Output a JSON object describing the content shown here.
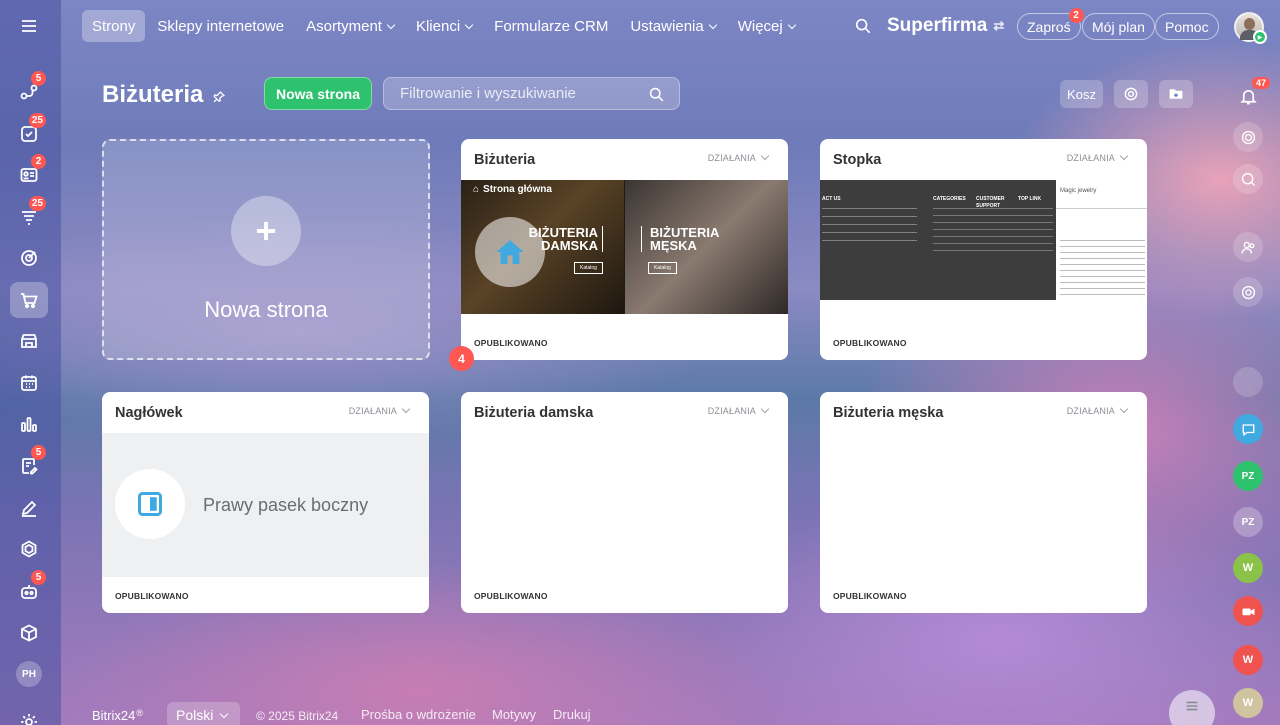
{
  "nav": {
    "items": [
      {
        "label": "Strony",
        "active": true,
        "dropdown": false
      },
      {
        "label": "Sklepy internetowe",
        "dropdown": false
      },
      {
        "label": "Asortyment",
        "dropdown": true
      },
      {
        "label": "Klienci",
        "dropdown": true
      },
      {
        "label": "Formularze CRM",
        "dropdown": false
      },
      {
        "label": "Ustawienia",
        "dropdown": true
      },
      {
        "label": "Więcej",
        "dropdown": true
      }
    ]
  },
  "header": {
    "company": "Superfirma",
    "invite": "Zaproś",
    "invite_badge": "2",
    "my_plan": "Mój plan",
    "help": "Pomoc"
  },
  "sidebar": {
    "badges": {
      "tasks": "5",
      "checklist": "25",
      "contacts": "2",
      "feed": "25",
      "docs": "5",
      "robot": "5"
    },
    "avatar_initials": "PH"
  },
  "page": {
    "title": "Biżuteria",
    "new_page_button": "Nowa strona",
    "search_placeholder": "Filtrowanie i wyszukiwanie",
    "trash_button": "Kosz",
    "new_page_tile_label": "Nowa strona",
    "floating_badge": "4"
  },
  "cards": [
    {
      "title": "Biżuteria",
      "actions": "DZIAŁANIA",
      "status": "OPUBLIKOWANO",
      "preview": {
        "home_label": "Strona główna",
        "banner_left": "BIŻUTERIA DAMSKA",
        "banner_right": "BIŻUTERIA MĘSKA",
        "button": "Katalog"
      }
    },
    {
      "title": "Stopka",
      "actions": "DZIAŁANIA",
      "status": "OPUBLIKOWANO",
      "preview": {
        "col1": "ACT US",
        "col2": "CATEGORIES",
        "col3": "CUSTOMER SUPPORT",
        "col4": "TOP LINK",
        "brand": "Magic jewelry"
      }
    },
    {
      "title": "Nagłówek",
      "actions": "DZIAŁANIA",
      "status": "OPUBLIKOWANO",
      "preview": {
        "label": "Prawy pasek boczny"
      }
    },
    {
      "title": "Biżuteria damska",
      "actions": "DZIAŁANIA",
      "status": "OPUBLIKOWANO"
    },
    {
      "title": "Biżuteria męska",
      "actions": "DZIAŁANIA",
      "status": "OPUBLIKOWANO"
    }
  ],
  "right_rail": {
    "notifications_badge": "47",
    "avatars": [
      "PZ",
      "PZ",
      "W",
      "W",
      "W"
    ]
  },
  "footer": {
    "brand": "Bitrix24",
    "language": "Polski",
    "copyright": "© 2025 Bitrix24",
    "implementation_request": "Prośba o wdrożenie",
    "themes": "Motywy",
    "print": "Drukuj"
  }
}
